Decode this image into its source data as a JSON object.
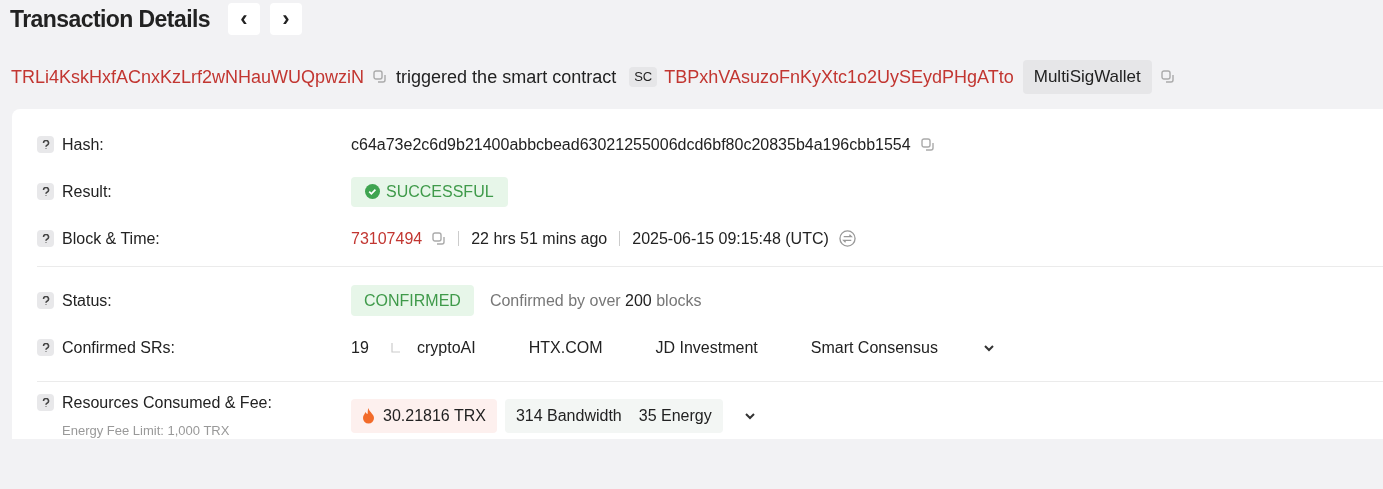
{
  "title": "Transaction Details",
  "nav": [
    "‹",
    "›"
  ],
  "summary": {
    "from": "TRLi4KskHxfACnxKzLrf2wNHauWUQpwziN",
    "action": "triggered the smart contract",
    "contract_tag": "SC",
    "contract": "TBPxhVAsuzoFnKyXtc1o2UySEydPHgATto",
    "contract_name": "MultiSigWallet"
  },
  "groups": [
    [
      {
        "kind": "hash",
        "label": "Hash:",
        "value": "c64a73e2c6d9b21400abbcbead63021255006dcd6bf80c20835b4a196cbb1554"
      },
      {
        "kind": "result",
        "label": "Result:",
        "value": "SUCCESSFUL"
      },
      {
        "kind": "block",
        "label": "Block & Time:",
        "block": "73107494",
        "age": "22 hrs 51 mins ago",
        "time": "2025-06-15 09:15:48 (UTC)"
      }
    ],
    [
      {
        "kind": "status",
        "label": "Status:",
        "value": "CONFIRMED",
        "note": "Confirmed by over **200** blocks"
      },
      {
        "kind": "srs",
        "label": "Confirmed SRs:",
        "count": "19",
        "names": [
          "cryptoAI",
          "HTX.COM",
          "JD Investment",
          "Smart Consensus"
        ]
      }
    ],
    [
      {
        "kind": "fee",
        "label": "Resources Consumed & Fee:",
        "sublabel": "Energy Fee Limit: 1,000 TRX",
        "fee": "30.21816 TRX",
        "resources": [
          "314 Bandwidth",
          "35 Energy"
        ]
      }
    ]
  ]
}
